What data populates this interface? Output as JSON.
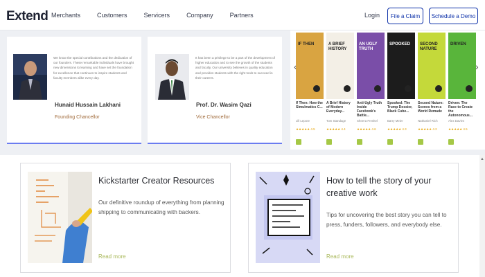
{
  "nav": {
    "logo": "Extend",
    "links": [
      "Merchants",
      "Customers",
      "Servicers",
      "Company",
      "Partners"
    ],
    "login": "Login",
    "file_claim": "File a Claim",
    "schedule_demo": "Schedule a Demo"
  },
  "testimonials": [
    {
      "quote": "We know the special contributions and the dedication of our founders. These remarkable individuals have brought new dimensions to learning and have set the foundation for excellence that continues to inspire students and faculty members alike every day.",
      "name": "Hunaid Hussain Lakhani",
      "role": "Founding Chancellor"
    },
    {
      "quote": "It has been a privilege to be a part of the development of higher education and to see the growth of the students and faculty. Our university believes in quality education and provides students with the right tools to succeed in their careers.",
      "name": "Prof. Dr. Wasim Qazi",
      "role": "Vice Chancellor"
    }
  ],
  "books": [
    {
      "title": "If Then: How the Simulmatics C...",
      "author": "Jill Lepore",
      "cover_text": "IF THEN",
      "cover_color": "#d9a441",
      "stars": "★★★★★ 4.5"
    },
    {
      "title": "A Brief History of Modern Everyday...",
      "author": "Tom Standage",
      "cover_text": "A BRIEF HISTORY",
      "cover_color": "#f3efe6",
      "stars": "★★★★★ 4.4"
    },
    {
      "title": "Anti-Ugly Truth Inside Facebook's Battle...",
      "author": "Sheera Frenkel",
      "cover_text": "AN UGLY TRUTH",
      "cover_color": "#7a4ea8",
      "stars": "★★★★★ 4.6"
    },
    {
      "title": "Spooked: The Trump Dossier, Black Cube...",
      "author": "Barry Meier",
      "cover_text": "SPOOKED",
      "cover_color": "#1c1c1c",
      "stars": "★★★★★ 4.3"
    },
    {
      "title": "Second Nature: Scenes from a World Remade",
      "author": "Nathaniel Rich",
      "cover_text": "SECOND NATURE",
      "cover_color": "#c4d93a",
      "stars": "★★★★★ 4.2"
    },
    {
      "title": "Driven: The Race to Create the Autonomous...",
      "author": "Alex Davies",
      "cover_text": "DRIVEN",
      "cover_color": "#59b53b",
      "stars": "★★★★★ 4.5"
    }
  ],
  "resources": [
    {
      "title": "Kickstarter Creator Resources",
      "desc": "Our definitive roundup of everything from planning shipping to communicating with backers.",
      "more": "Read more"
    },
    {
      "title": "How to tell the story of your creative work",
      "desc": "Tips for uncovering the best story you can tell to press, funders, followers, and everybody else.",
      "more": "Read more"
    }
  ],
  "colors": {
    "accent": "#0b2fa8",
    "underline": "#6b7cf0",
    "readmore": "#a9b85a",
    "badge": "#a5c846"
  }
}
